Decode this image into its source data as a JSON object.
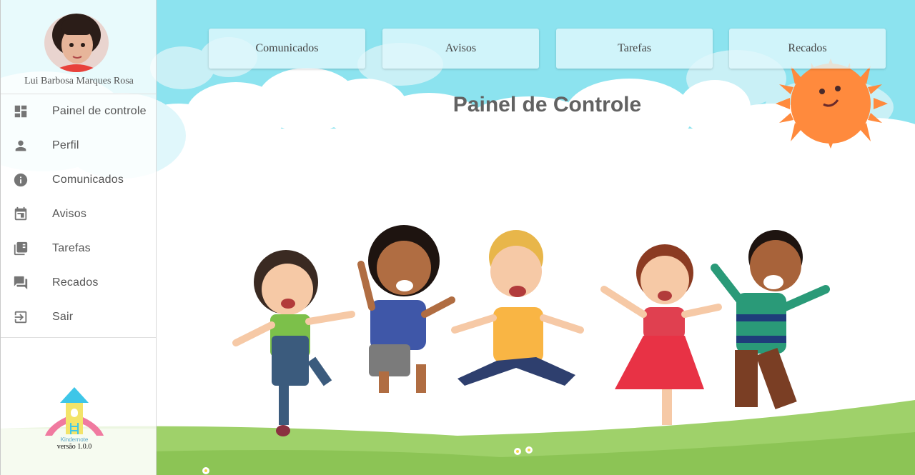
{
  "user": {
    "name": "Lui Barbosa Marques Rosa"
  },
  "sidebar": {
    "items": [
      {
        "label": "Painel de controle",
        "icon": "dashboard-icon"
      },
      {
        "label": "Perfil",
        "icon": "person-icon"
      },
      {
        "label": "Comunicados",
        "icon": "info-icon"
      },
      {
        "label": "Avisos",
        "icon": "calendar-icon"
      },
      {
        "label": "Tarefas",
        "icon": "library-books-icon"
      },
      {
        "label": "Recados",
        "icon": "forum-icon"
      },
      {
        "label": "Sair",
        "icon": "exit-icon"
      }
    ],
    "brand_name": "Kindernote",
    "version": "versão 1.0.0"
  },
  "topnav": {
    "items": [
      "Comunicados",
      "Avisos",
      "Tarefas",
      "Recados"
    ]
  },
  "main": {
    "title": "Painel de Controle"
  },
  "colors": {
    "sky": "#8ce3ef",
    "cloud": "#ffffff",
    "grass": "#9fd16a",
    "sun": "#ff8a3d",
    "icon_gray": "#757575"
  }
}
